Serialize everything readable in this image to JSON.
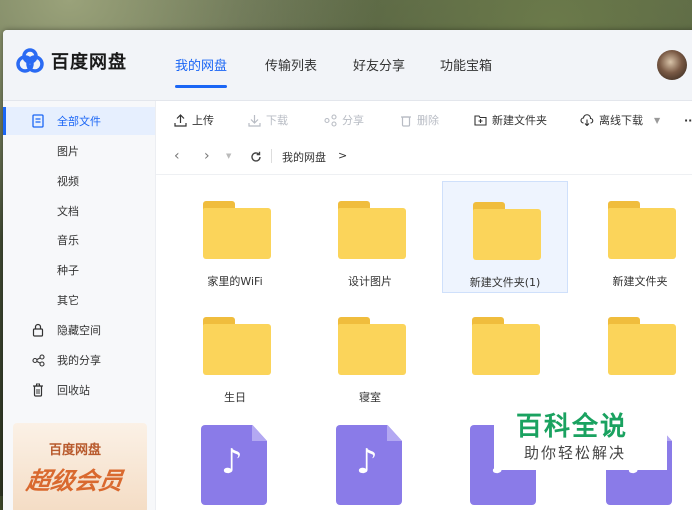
{
  "app": {
    "name": "百度网盘"
  },
  "nav": {
    "tabs": [
      {
        "label": "我的网盘",
        "active": true
      },
      {
        "label": "传输列表",
        "active": false
      },
      {
        "label": "好友分享",
        "active": false
      },
      {
        "label": "功能宝箱",
        "active": false
      }
    ]
  },
  "sidebar": {
    "items": [
      {
        "label": "全部文件",
        "icon": "document-icon",
        "active": true
      },
      {
        "label": "图片"
      },
      {
        "label": "视频"
      },
      {
        "label": "文档"
      },
      {
        "label": "音乐"
      },
      {
        "label": "种子"
      },
      {
        "label": "其它"
      },
      {
        "label": "隐藏空间",
        "icon": "lock-icon"
      },
      {
        "label": "我的分享",
        "icon": "share-icon"
      },
      {
        "label": "回收站",
        "icon": "trash-icon"
      }
    ],
    "promo": {
      "line1": "百度网盘",
      "line2": "超级会员"
    }
  },
  "toolbar": {
    "upload": "上传",
    "download": "下载",
    "share": "分享",
    "delete": "删除",
    "new_folder": "新建文件夹",
    "offline_download": "离线下载",
    "more": "···"
  },
  "path": {
    "current": "我的网盘",
    "separator": ">"
  },
  "files": [
    {
      "name": "家里的WiFi",
      "type": "folder"
    },
    {
      "name": "设计图片",
      "type": "folder"
    },
    {
      "name": "新建文件夹(1)",
      "type": "folder",
      "selected": true
    },
    {
      "name": "新建文件夹",
      "type": "folder"
    },
    {
      "name": "生日",
      "type": "folder"
    },
    {
      "name": "寝室",
      "type": "folder"
    },
    {
      "name": "",
      "type": "folder"
    },
    {
      "name": "",
      "type": "folder"
    },
    {
      "name": "",
      "type": "music"
    },
    {
      "name": "",
      "type": "music"
    },
    {
      "name": "",
      "type": "music"
    },
    {
      "name": "",
      "type": "music"
    }
  ],
  "watermark": {
    "line1": "百科全说",
    "line2": "助你轻松解决"
  },
  "colors": {
    "accent": "#1b66f5",
    "folder": "#fbd45a",
    "music": "#8a7be8",
    "watermark": "#1aa260"
  }
}
